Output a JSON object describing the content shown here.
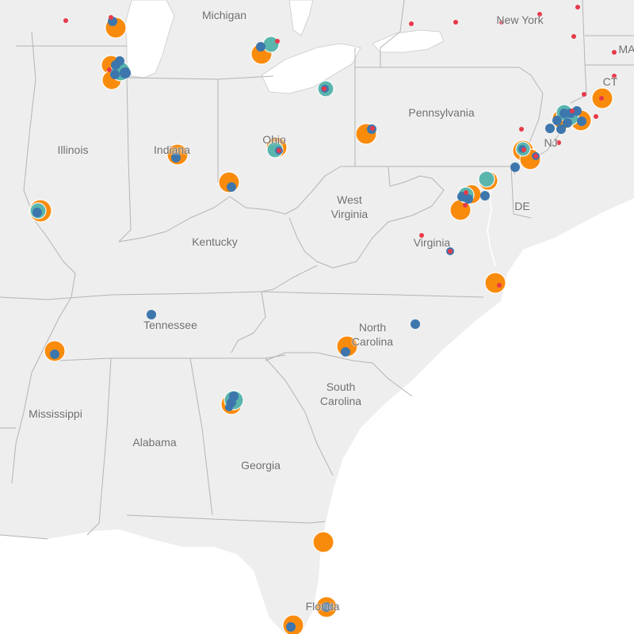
{
  "map": {
    "state_labels": [
      {
        "id": "michigan",
        "text": "Michigan"
      },
      {
        "id": "new-york",
        "text": "New York"
      },
      {
        "id": "massachusetts",
        "text": "MA"
      },
      {
        "id": "connecticut",
        "text": "CT"
      },
      {
        "id": "pennsylvania",
        "text": "Pennsylvania"
      },
      {
        "id": "illinois",
        "text": "Illinois"
      },
      {
        "id": "indiana",
        "text": "Indiana"
      },
      {
        "id": "ohio",
        "text": "Ohio"
      },
      {
        "id": "new-jersey",
        "text": "NJ"
      },
      {
        "id": "west-virginia",
        "text": "West\nVirginia"
      },
      {
        "id": "delaware",
        "text": "DE"
      },
      {
        "id": "kentucky",
        "text": "Kentucky"
      },
      {
        "id": "virginia",
        "text": "Virginia"
      },
      {
        "id": "tennessee",
        "text": "Tennessee"
      },
      {
        "id": "north-carolina",
        "text": "North\nCarolina"
      },
      {
        "id": "south-carolina",
        "text": "South\nCarolina"
      },
      {
        "id": "mississippi",
        "text": "Mississippi"
      },
      {
        "id": "alabama",
        "text": "Alabama"
      },
      {
        "id": "georgia",
        "text": "Georgia"
      },
      {
        "id": "florida",
        "text": "Florida"
      }
    ],
    "marker_colors": {
      "orange": "#f98b0c",
      "teal": "#5ab5ad",
      "blue": "#3d76ad",
      "red": "#e8394a"
    },
    "colors": {
      "land": "#eeeeee",
      "water": "#ffffff",
      "border": "#b4b4b4"
    }
  }
}
